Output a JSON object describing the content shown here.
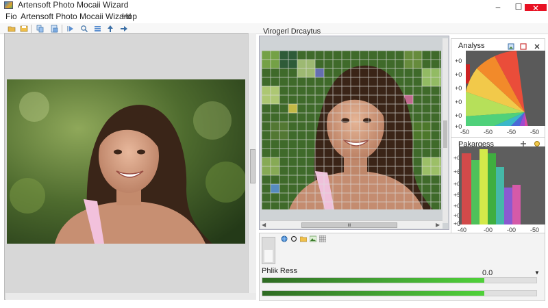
{
  "window": {
    "title": "Artensoft Photo Mocaii Wizard",
    "minimize_glyph": "–",
    "maximize_glyph": "☐",
    "close_glyph": "✕"
  },
  "menu": {
    "items": [
      "Fio",
      "Artensoft Photo Mocaii Wizard",
      "Hop"
    ]
  },
  "toolbar": {
    "icons": [
      "open-folder-icon",
      "save-icon",
      "copy-icon",
      "paste-icon",
      "play-icon",
      "zoom-icon",
      "layers-icon",
      "up-arrow-icon",
      "forward-arrow-icon"
    ]
  },
  "mosaic": {
    "header": "Virogerl Drcaytus",
    "hscroll_glyph": "ıı"
  },
  "analysis": {
    "title": "Analyss",
    "y_ticks": [
      "+0",
      "+0",
      "+0",
      "+0",
      "+0",
      "+0"
    ],
    "x_ticks": [
      "-50",
      "-50",
      "-50",
      "-50"
    ],
    "icons": [
      "picture-icon",
      "stop-icon",
      "close-icon"
    ]
  },
  "histogram": {
    "title": "Pakargess",
    "y_ticks": [
      "+0",
      "+6",
      "+0",
      "+5",
      "+0",
      "+0",
      "+0"
    ],
    "x_ticks": [
      "-40",
      "-00",
      "-00",
      "-50"
    ],
    "icons": [
      "add-icon",
      "status-icon"
    ]
  },
  "lower": {
    "tool_icons": [
      "globe-icon",
      "circle-icon",
      "folder-icon",
      "image-icon",
      "grid-icon"
    ]
  },
  "progress": {
    "label": "Phlik Ress",
    "value": "0.0",
    "bar1_fraction": 0.81,
    "bar2_fraction": 0.81
  },
  "colors": {
    "accent_green": "#43a433",
    "close_red": "#e81123"
  }
}
